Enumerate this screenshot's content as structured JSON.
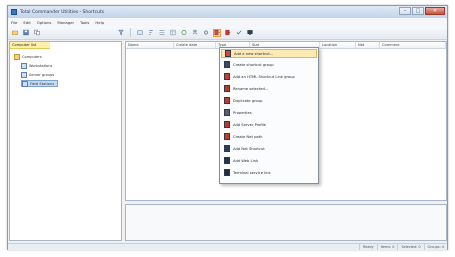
{
  "window": {
    "title": "Total Commander Utilities - Shortcuts"
  },
  "menubar": [
    "File",
    "Edit",
    "Options",
    "Manager",
    "Tools",
    "Help"
  ],
  "tree": {
    "header": "Computer list",
    "nodes": [
      "Computers",
      "Workstations",
      "Server groups",
      "Field Stations"
    ]
  },
  "list": {
    "columns": [
      "Name",
      "Create date",
      "Type",
      "Size",
      "Location",
      "Net",
      "Comment"
    ]
  },
  "dropdown": {
    "items": [
      "Add a new shortcut...",
      "Create shortcut group",
      "Add an HTML Shortcut Link group",
      "Rename selected...",
      "Duplicate group",
      "Properties",
      "Add Server Profile",
      "Create Net path",
      "Add Net Shortcut",
      "Add Web Link",
      "Terminal service link"
    ]
  },
  "statusbar": [
    "Ready",
    "Items: 0",
    "Selected: 0",
    "Groups: 4"
  ],
  "colors": {
    "highlight": "#fde9b3",
    "selection": "#c5dcf5",
    "titlebar": "#c2d3ea"
  }
}
